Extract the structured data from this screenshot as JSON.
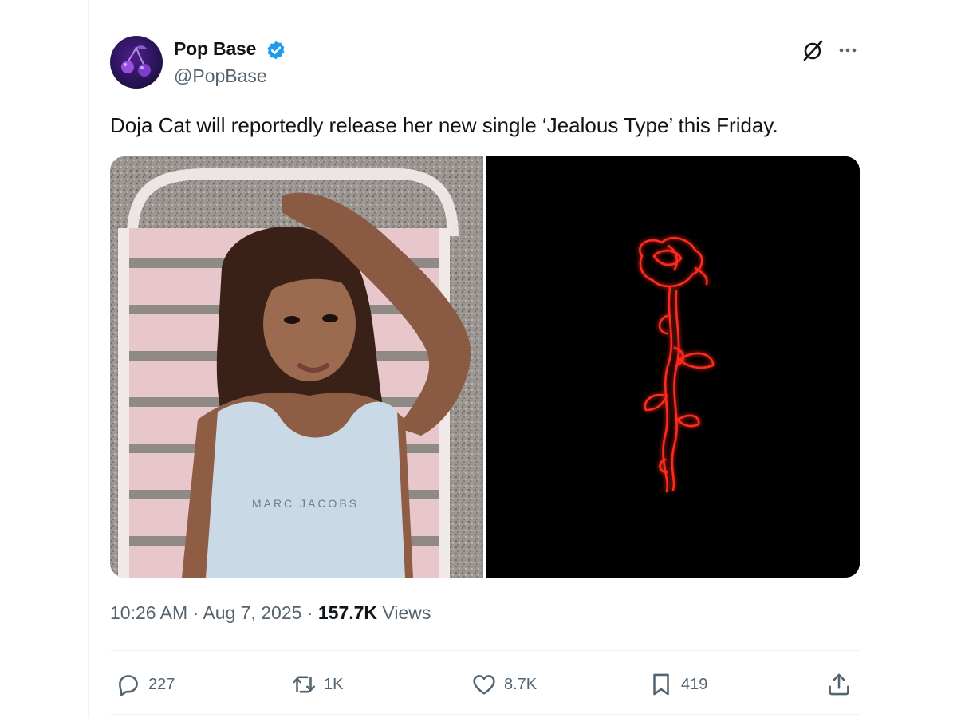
{
  "author": {
    "display_name": "Pop Base",
    "handle": "@PopBase",
    "verified": true
  },
  "tweet": {
    "text": "Doja Cat will reportedly release her new single ‘Jealous Type’ this Friday.",
    "shirt_text": "MARC JACOBS"
  },
  "meta": {
    "time": "10:26 AM",
    "sep1": " · ",
    "date": "Aug 7, 2025",
    "sep2": " · ",
    "views_count": "157.7K",
    "views_label": " Views"
  },
  "actions": {
    "replies": "227",
    "reposts": "1K",
    "likes": "8.7K",
    "bookmarks": "419"
  },
  "colors": {
    "text_primary": "#0f1419",
    "text_secondary": "#536471",
    "verified_blue": "#1d9bf0",
    "neon_red": "#ff2a1a"
  },
  "icons": {
    "grok": "grok-icon",
    "more": "more-icon",
    "reply": "reply-icon",
    "repost": "repost-icon",
    "like": "heart-icon",
    "bookmark": "bookmark-icon",
    "share": "share-icon"
  }
}
